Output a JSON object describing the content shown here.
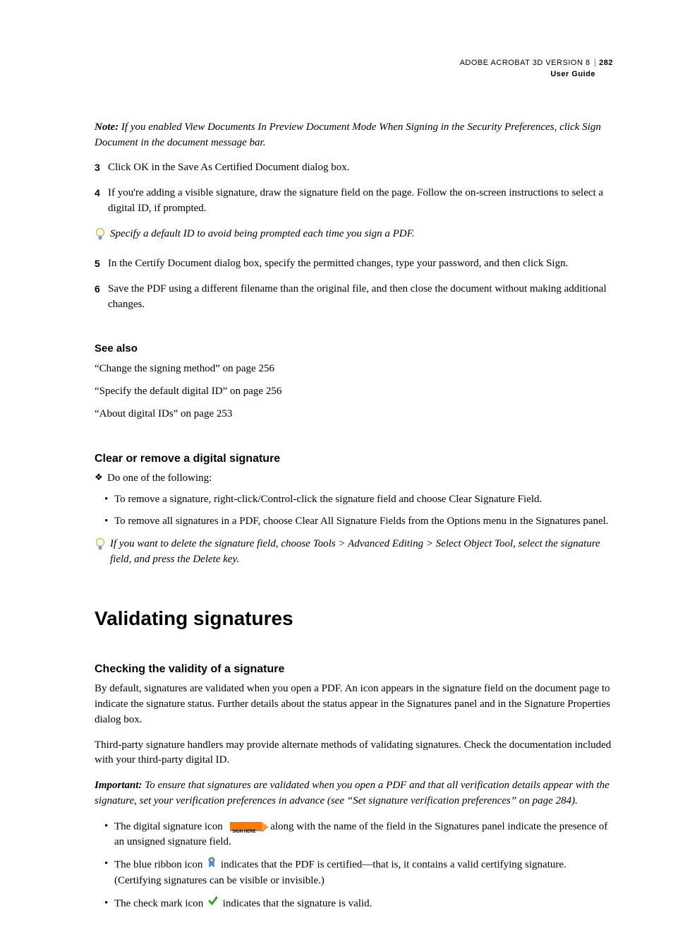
{
  "header": {
    "product": "ADOBE ACROBAT 3D VERSION 8",
    "page_num": "282",
    "subtitle": "User Guide"
  },
  "note": {
    "label": "Note:",
    "text": "If you enabled View Documents In Preview Document Mode When Signing in the Security Preferences, click Sign Document in the document message bar."
  },
  "steps": {
    "s3": {
      "num": "3",
      "text": "Click OK in the Save As Certified Document dialog box."
    },
    "s4": {
      "num": "4",
      "text": "If you're adding a visible signature, draw the signature field on the page. Follow the on-screen instructions to select a digital ID, if prompted."
    },
    "s5": {
      "num": "5",
      "text": "In the Certify Document dialog box, specify the permitted changes, type your password, and then click Sign."
    },
    "s6": {
      "num": "6",
      "text": "Save the PDF using a different filename than the original file, and then close the document without making additional changes."
    }
  },
  "tip1": "Specify a default ID to avoid being prompted each time you sign a PDF.",
  "see_also": {
    "heading": "See also",
    "items": [
      "“Change the signing method” on page 256",
      "“Specify the default digital ID” on page 256",
      "“About digital IDs” on page 253"
    ]
  },
  "clear_section": {
    "heading": "Clear or remove a digital signature",
    "lead": "Do one of the following:",
    "bullets": [
      "To remove a signature, right-click/Control-click the signature field and choose Clear Signature Field.",
      "To remove all signatures in a PDF, choose Clear All Signature Fields from the Options menu in the Signatures panel."
    ],
    "tip": "If you want to delete the signature field, choose Tools > Advanced Editing > Select Object Tool, select the signature field, and press the Delete key."
  },
  "main_heading": "Validating signatures",
  "checking": {
    "heading": "Checking the validity of a signature",
    "p1": "By default, signatures are validated when you open a PDF. An icon appears in the signature field on the document page to indicate the signature status. Further details about the status appear in the Signatures panel and in the Signature Properties dialog box.",
    "p2": "Third-party signature handlers may provide alternate methods of validating signatures. Check the documentation included with your third-party digital ID.",
    "important_label": "Important:",
    "important": "To ensure that signatures are validated when you open a PDF and that all verification details appear with the signature, set your verification preferences in advance (see “Set signature verification preferences” on page 284).",
    "b1a": "The digital signature icon",
    "b1b": "along with the name of the field in the Signatures panel indicate the presence of an unsigned signature field.",
    "b2a": "The blue ribbon icon",
    "b2b": "indicates that the PDF is certified—that is, it contains a valid certifying signature. (Certifying signatures can be visible or invisible.)",
    "b3a": "The check mark icon",
    "b3b": "indicates that the signature is valid."
  },
  "icons": {
    "sig_tag_label": "SIGN HERE"
  }
}
